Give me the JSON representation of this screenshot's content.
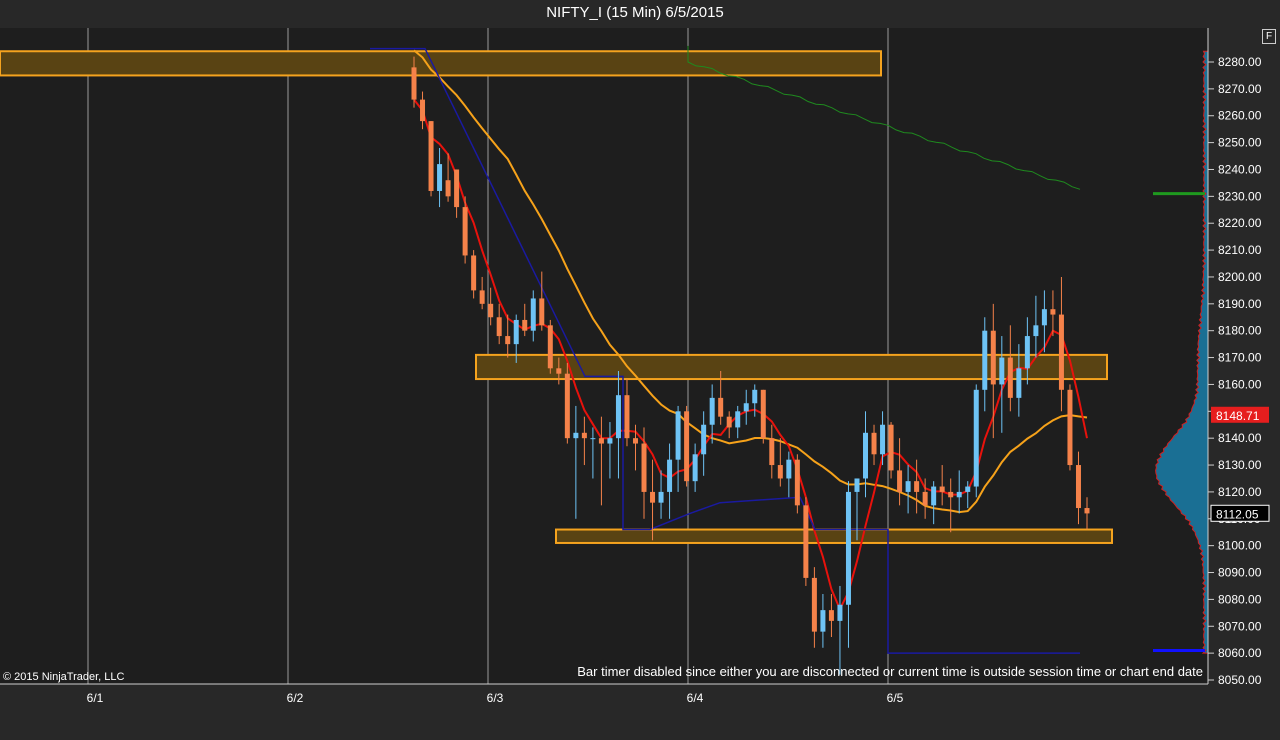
{
  "title": "NIFTY_I (15 Min)  6/5/2015",
  "f_label": "F",
  "copyright": "© 2015 NinjaTrader, LLC",
  "bar_timer_message": "Bar timer disabled since either you are disconnected or current time is outside session time or chart end date",
  "colors": {
    "background": "#282828",
    "plot_background": "#1e1e1e",
    "up_candle": "#6ec3f5",
    "down_candle": "#f5824a",
    "fast_ma": "#e8120c",
    "slow_ma": "#f6a21a",
    "zone_fill": "#594313",
    "zone_border": "#f5a31e",
    "vwap_line": "#1a1aa0",
    "green_line": "#1f8a1f",
    "volume_profile_fill": "#1a6f94",
    "volume_profile_edge": "#d22020",
    "price_marker_last": "#e61e1e",
    "grid": "#9a9a9a"
  },
  "chart_data": {
    "type": "candlestick",
    "symbol": "NIFTY_I",
    "interval": "15 Min",
    "ylim": [
      8045,
      8290
    ],
    "y_ticks": [
      8050.0,
      8060.0,
      8070.0,
      8080.0,
      8090.0,
      8100.0,
      8110.0,
      8120.0,
      8130.0,
      8140.0,
      8150.0,
      8160.0,
      8170.0,
      8180.0,
      8190.0,
      8200.0,
      8210.0,
      8220.0,
      8230.0,
      8240.0,
      8250.0,
      8260.0,
      8270.0,
      8280.0
    ],
    "x_labels": [
      "6/1",
      "6/2",
      "6/3",
      "6/4",
      "6/5"
    ],
    "grid_vertical": true,
    "last_price": "8148.71",
    "current_price": "8112.05",
    "candles": [
      [
        8278,
        8282,
        8263,
        8266
      ],
      [
        8266,
        8269,
        8255,
        8258
      ],
      [
        8258,
        8258,
        8230,
        8232
      ],
      [
        8232,
        8248,
        8226,
        8242
      ],
      [
        8236,
        8246,
        8228,
        8230
      ],
      [
        8240,
        8240,
        8222,
        8226
      ],
      [
        8226,
        8230,
        8205,
        8208
      ],
      [
        8208,
        8210,
        8192,
        8195
      ],
      [
        8195,
        8200,
        8188,
        8190
      ],
      [
        8190,
        8196,
        8182,
        8185
      ],
      [
        8185,
        8190,
        8175,
        8178
      ],
      [
        8178,
        8186,
        8170,
        8175
      ],
      [
        8175,
        8186,
        8168,
        8184
      ],
      [
        8184,
        8190,
        8178,
        8180
      ],
      [
        8180,
        8195,
        8176,
        8192
      ],
      [
        8192,
        8202,
        8180,
        8182
      ],
      [
        8182,
        8184,
        8164,
        8166
      ],
      [
        8166,
        8170,
        8160,
        8164
      ],
      [
        8164,
        8168,
        8138,
        8140
      ],
      [
        8140,
        8152,
        8110,
        8142
      ],
      [
        8142,
        8148,
        8130,
        8140
      ],
      [
        8140,
        8144,
        8125,
        8140
      ],
      [
        8140,
        8148,
        8115,
        8138
      ],
      [
        8138,
        8146,
        8125,
        8140
      ],
      [
        8140,
        8165,
        8125,
        8156
      ],
      [
        8156,
        8162,
        8137,
        8140
      ],
      [
        8140,
        8145,
        8128,
        8138
      ],
      [
        8138,
        8144,
        8110,
        8120
      ],
      [
        8120,
        8132,
        8102,
        8116
      ],
      [
        8116,
        8128,
        8110,
        8120
      ],
      [
        8120,
        8138,
        8110,
        8132
      ],
      [
        8132,
        8152,
        8120,
        8150
      ],
      [
        8150,
        8152,
        8122,
        8124
      ],
      [
        8124,
        8138,
        8120,
        8134
      ],
      [
        8134,
        8150,
        8126,
        8145
      ],
      [
        8145,
        8160,
        8138,
        8155
      ],
      [
        8155,
        8165,
        8145,
        8148
      ],
      [
        8148,
        8150,
        8140,
        8144
      ],
      [
        8144,
        8152,
        8140,
        8150
      ],
      [
        8150,
        8158,
        8145,
        8153
      ],
      [
        8153,
        8160,
        8148,
        8158
      ],
      [
        8158,
        8158,
        8138,
        8140
      ],
      [
        8140,
        8145,
        8125,
        8130
      ],
      [
        8130,
        8140,
        8122,
        8125
      ],
      [
        8125,
        8135,
        8118,
        8132
      ],
      [
        8132,
        8134,
        8112,
        8115
      ],
      [
        8115,
        8118,
        8085,
        8088
      ],
      [
        8088,
        8092,
        8062,
        8068
      ],
      [
        8068,
        8082,
        8062,
        8076
      ],
      [
        8076,
        8082,
        8066,
        8072
      ],
      [
        8072,
        8085,
        8052,
        8078
      ],
      [
        8078,
        8124,
        8062,
        8120
      ],
      [
        8120,
        8125,
        8102,
        8125
      ],
      [
        8125,
        8150,
        8118,
        8142
      ],
      [
        8142,
        8145,
        8130,
        8134
      ],
      [
        8134,
        8150,
        8130,
        8145
      ],
      [
        8145,
        8146,
        8125,
        8128
      ],
      [
        8128,
        8140,
        8115,
        8120
      ],
      [
        8120,
        8130,
        8112,
        8124
      ],
      [
        8124,
        8132,
        8112,
        8120
      ],
      [
        8120,
        8125,
        8110,
        8115
      ],
      [
        8115,
        8124,
        8108,
        8122
      ],
      [
        8122,
        8130,
        8115,
        8120
      ],
      [
        8120,
        8125,
        8105,
        8118
      ],
      [
        8118,
        8128,
        8112,
        8120
      ],
      [
        8120,
        8124,
        8114,
        8122
      ],
      [
        8122,
        8160,
        8118,
        8158
      ],
      [
        8158,
        8185,
        8150,
        8180
      ],
      [
        8180,
        8190,
        8140,
        8160
      ],
      [
        8160,
        8178,
        8142,
        8170
      ],
      [
        8170,
        8182,
        8150,
        8155
      ],
      [
        8155,
        8175,
        8148,
        8166
      ],
      [
        8166,
        8185,
        8160,
        8178
      ],
      [
        8178,
        8193,
        8170,
        8182
      ],
      [
        8182,
        8195,
        8172,
        8188
      ],
      [
        8188,
        8195,
        8178,
        8186
      ],
      [
        8186,
        8200,
        8150,
        8158
      ],
      [
        8158,
        8160,
        8128,
        8130
      ],
      [
        8130,
        8135,
        8108,
        8114
      ],
      [
        8114,
        8118,
        8106,
        8112
      ]
    ],
    "fast_ma_label": "",
    "zones": [
      {
        "top": 8284,
        "bottom": 8275
      },
      {
        "top": 8171,
        "bottom": 8162
      },
      {
        "top": 8106,
        "bottom": 8101
      }
    ]
  }
}
